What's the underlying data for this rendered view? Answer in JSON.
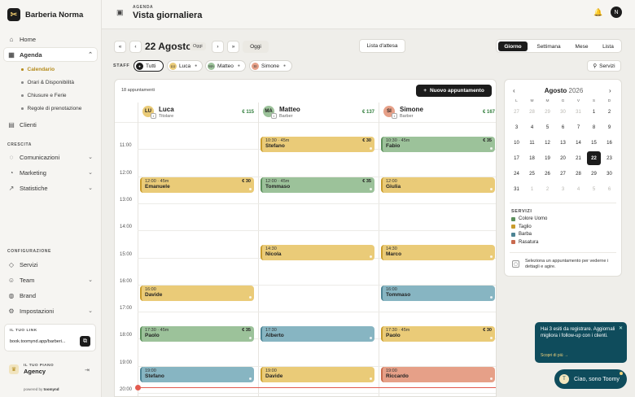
{
  "brand": {
    "name": "Barberia Norma",
    "logo_letter": "✂"
  },
  "sidebar": {
    "home": "Home",
    "agenda": "Agenda",
    "agenda_sub": [
      "Calendario",
      "Orari & Disponibilità",
      "Chiusure e Ferie",
      "Regole di prenotazione"
    ],
    "clienti": "Clienti",
    "section_crescita": "CRESCITA",
    "comunicazioni": "Comunicazioni",
    "marketing": "Marketing",
    "statistiche": "Statistiche",
    "section_config": "CONFIGURAZIONE",
    "servizi": "Servizi",
    "team": "Team",
    "brand": "Brand",
    "impostazioni": "Impostazioni",
    "link_label": "IL TUO LINK",
    "link_url": "book.toomynd.app/barberi...",
    "plan_label": "IL TUO PIANO",
    "plan_value": "Agency",
    "powered_prefix": "powered by",
    "powered_brand": "toomynd"
  },
  "header": {
    "subtitle": "AGENDA",
    "title": "Vista giornaliera",
    "avatar_letter": "N"
  },
  "toolbar": {
    "date": "22 Agosto",
    "today_pill": "Oggi",
    "oggi_button": "Oggi",
    "waitlist": "Lista d'attesa",
    "views": [
      "Giorno",
      "Settimana",
      "Mese",
      "Lista"
    ],
    "active_view": "Giorno"
  },
  "staff_filter": {
    "label": "STAFF",
    "chips": [
      {
        "label": "Tutti",
        "initials": "●"
      },
      {
        "label": "Luca",
        "initials": "LU"
      },
      {
        "label": "Matteo",
        "initials": "MA"
      },
      {
        "label": "Simone",
        "initials": "SI"
      }
    ],
    "servizi_button": "Servizi"
  },
  "calendar": {
    "count_label": "18 appuntamenti",
    "new_button": "Nuovo appuntamento",
    "hours": [
      "11:00",
      "12:00",
      "13:00",
      "14:00",
      "15:00",
      "16:00",
      "17:00",
      "18:00",
      "19:00",
      "20:00"
    ],
    "columns": [
      {
        "initials": "LU",
        "name": "Luca",
        "role": "Titolare",
        "total": "€ 115",
        "avatar_color": "#eacb78"
      },
      {
        "initials": "MA",
        "name": "Matteo",
        "role": "Barber",
        "total": "€ 137",
        "avatar_color": "#9cc29a"
      },
      {
        "initials": "SI",
        "name": "Simone",
        "role": "Barber",
        "total": "€ 167",
        "avatar_color": "#e6a088"
      }
    ],
    "appointments": [
      {
        "col": 1,
        "start": "10:30",
        "time": "10:30 · 45m",
        "client": "Stefano",
        "price": "€ 30",
        "service": "taglio"
      },
      {
        "col": 2,
        "start": "10:30",
        "time": "10:30 · 45m",
        "client": "Fabio",
        "price": "€ 35",
        "service": "colore"
      },
      {
        "col": 0,
        "start": "12:00",
        "time": "12:00 · 45m",
        "client": "Emanuele",
        "price": "€ 30",
        "service": "taglio"
      },
      {
        "col": 1,
        "start": "12:00",
        "time": "12:00 · 45m",
        "client": "Tommaso",
        "price": "€ 35",
        "service": "colore"
      },
      {
        "col": 2,
        "start": "12:00",
        "time": "12:00",
        "client": "Giulia",
        "price": "",
        "service": "taglio"
      },
      {
        "col": 1,
        "start": "14:30",
        "time": "14:30",
        "client": "Nicola",
        "price": "",
        "service": "taglio"
      },
      {
        "col": 2,
        "start": "14:30",
        "time": "14:30",
        "client": "Marco",
        "price": "",
        "service": "taglio"
      },
      {
        "col": 0,
        "start": "16:00",
        "time": "16:00",
        "client": "Davide",
        "price": "",
        "service": "taglio"
      },
      {
        "col": 2,
        "start": "16:00",
        "time": "16:00",
        "client": "Tommaso",
        "price": "",
        "service": "barba"
      },
      {
        "col": 0,
        "start": "17:30",
        "time": "17:30 · 45m",
        "client": "Paolo",
        "price": "€ 35",
        "service": "colore"
      },
      {
        "col": 1,
        "start": "17:30",
        "time": "17:30",
        "client": "Alberto",
        "price": "",
        "service": "barba"
      },
      {
        "col": 2,
        "start": "17:30",
        "time": "17:30 · 45m",
        "client": "Paolo",
        "price": "€ 30",
        "service": "taglio"
      },
      {
        "col": 0,
        "start": "19:00",
        "time": "19:00",
        "client": "Stefano",
        "price": "",
        "service": "barba"
      },
      {
        "col": 1,
        "start": "19:00",
        "time": "19:00",
        "client": "Davide",
        "price": "",
        "service": "taglio"
      },
      {
        "col": 2,
        "start": "19:00",
        "time": "19:00",
        "client": "Riccardo",
        "price": "",
        "service": "rasatura"
      }
    ]
  },
  "mini_calendar": {
    "month": "Agosto",
    "year": "2026",
    "weekdays": [
      "L",
      "M",
      "M",
      "G",
      "V",
      "S",
      "D"
    ],
    "weeks": [
      [
        {
          "d": "27",
          "out": true
        },
        {
          "d": "28",
          "out": true
        },
        {
          "d": "29",
          "out": true
        },
        {
          "d": "30",
          "out": true
        },
        {
          "d": "31",
          "out": true
        },
        {
          "d": "1"
        },
        {
          "d": "2"
        }
      ],
      [
        {
          "d": "3"
        },
        {
          "d": "4"
        },
        {
          "d": "5"
        },
        {
          "d": "6"
        },
        {
          "d": "7"
        },
        {
          "d": "8"
        },
        {
          "d": "9"
        }
      ],
      [
        {
          "d": "10"
        },
        {
          "d": "11"
        },
        {
          "d": "12"
        },
        {
          "d": "13"
        },
        {
          "d": "14"
        },
        {
          "d": "15"
        },
        {
          "d": "16"
        }
      ],
      [
        {
          "d": "17"
        },
        {
          "d": "18"
        },
        {
          "d": "19"
        },
        {
          "d": "20"
        },
        {
          "d": "21"
        },
        {
          "d": "22",
          "sel": true
        },
        {
          "d": "23"
        }
      ],
      [
        {
          "d": "24"
        },
        {
          "d": "25"
        },
        {
          "d": "26"
        },
        {
          "d": "27"
        },
        {
          "d": "28"
        },
        {
          "d": "29"
        },
        {
          "d": "30"
        }
      ],
      [
        {
          "d": "31"
        },
        {
          "d": "1",
          "out": true
        },
        {
          "d": "2",
          "out": true
        },
        {
          "d": "3",
          "out": true
        },
        {
          "d": "4",
          "out": true
        },
        {
          "d": "5",
          "out": true
        },
        {
          "d": "6",
          "out": true
        }
      ]
    ],
    "services_label": "SERVIZI",
    "services": [
      {
        "name": "Colore Uomo",
        "color": "#5b8f5b"
      },
      {
        "name": "Taglio",
        "color": "#c99c2c"
      },
      {
        "name": "Barba",
        "color": "#4d8494"
      },
      {
        "name": "Rasatura",
        "color": "#c96a4e"
      }
    ],
    "hint": "Seleziona un appuntamento per vederne i dettagli e agire."
  },
  "promo": {
    "text": "Hai 3 esiti da registrare. Aggiornali migliora i follow-up con i clienti.",
    "link": "Scopri di più →"
  },
  "chat": {
    "label": "Ciao, sono Toomy",
    "avatar": "T"
  }
}
